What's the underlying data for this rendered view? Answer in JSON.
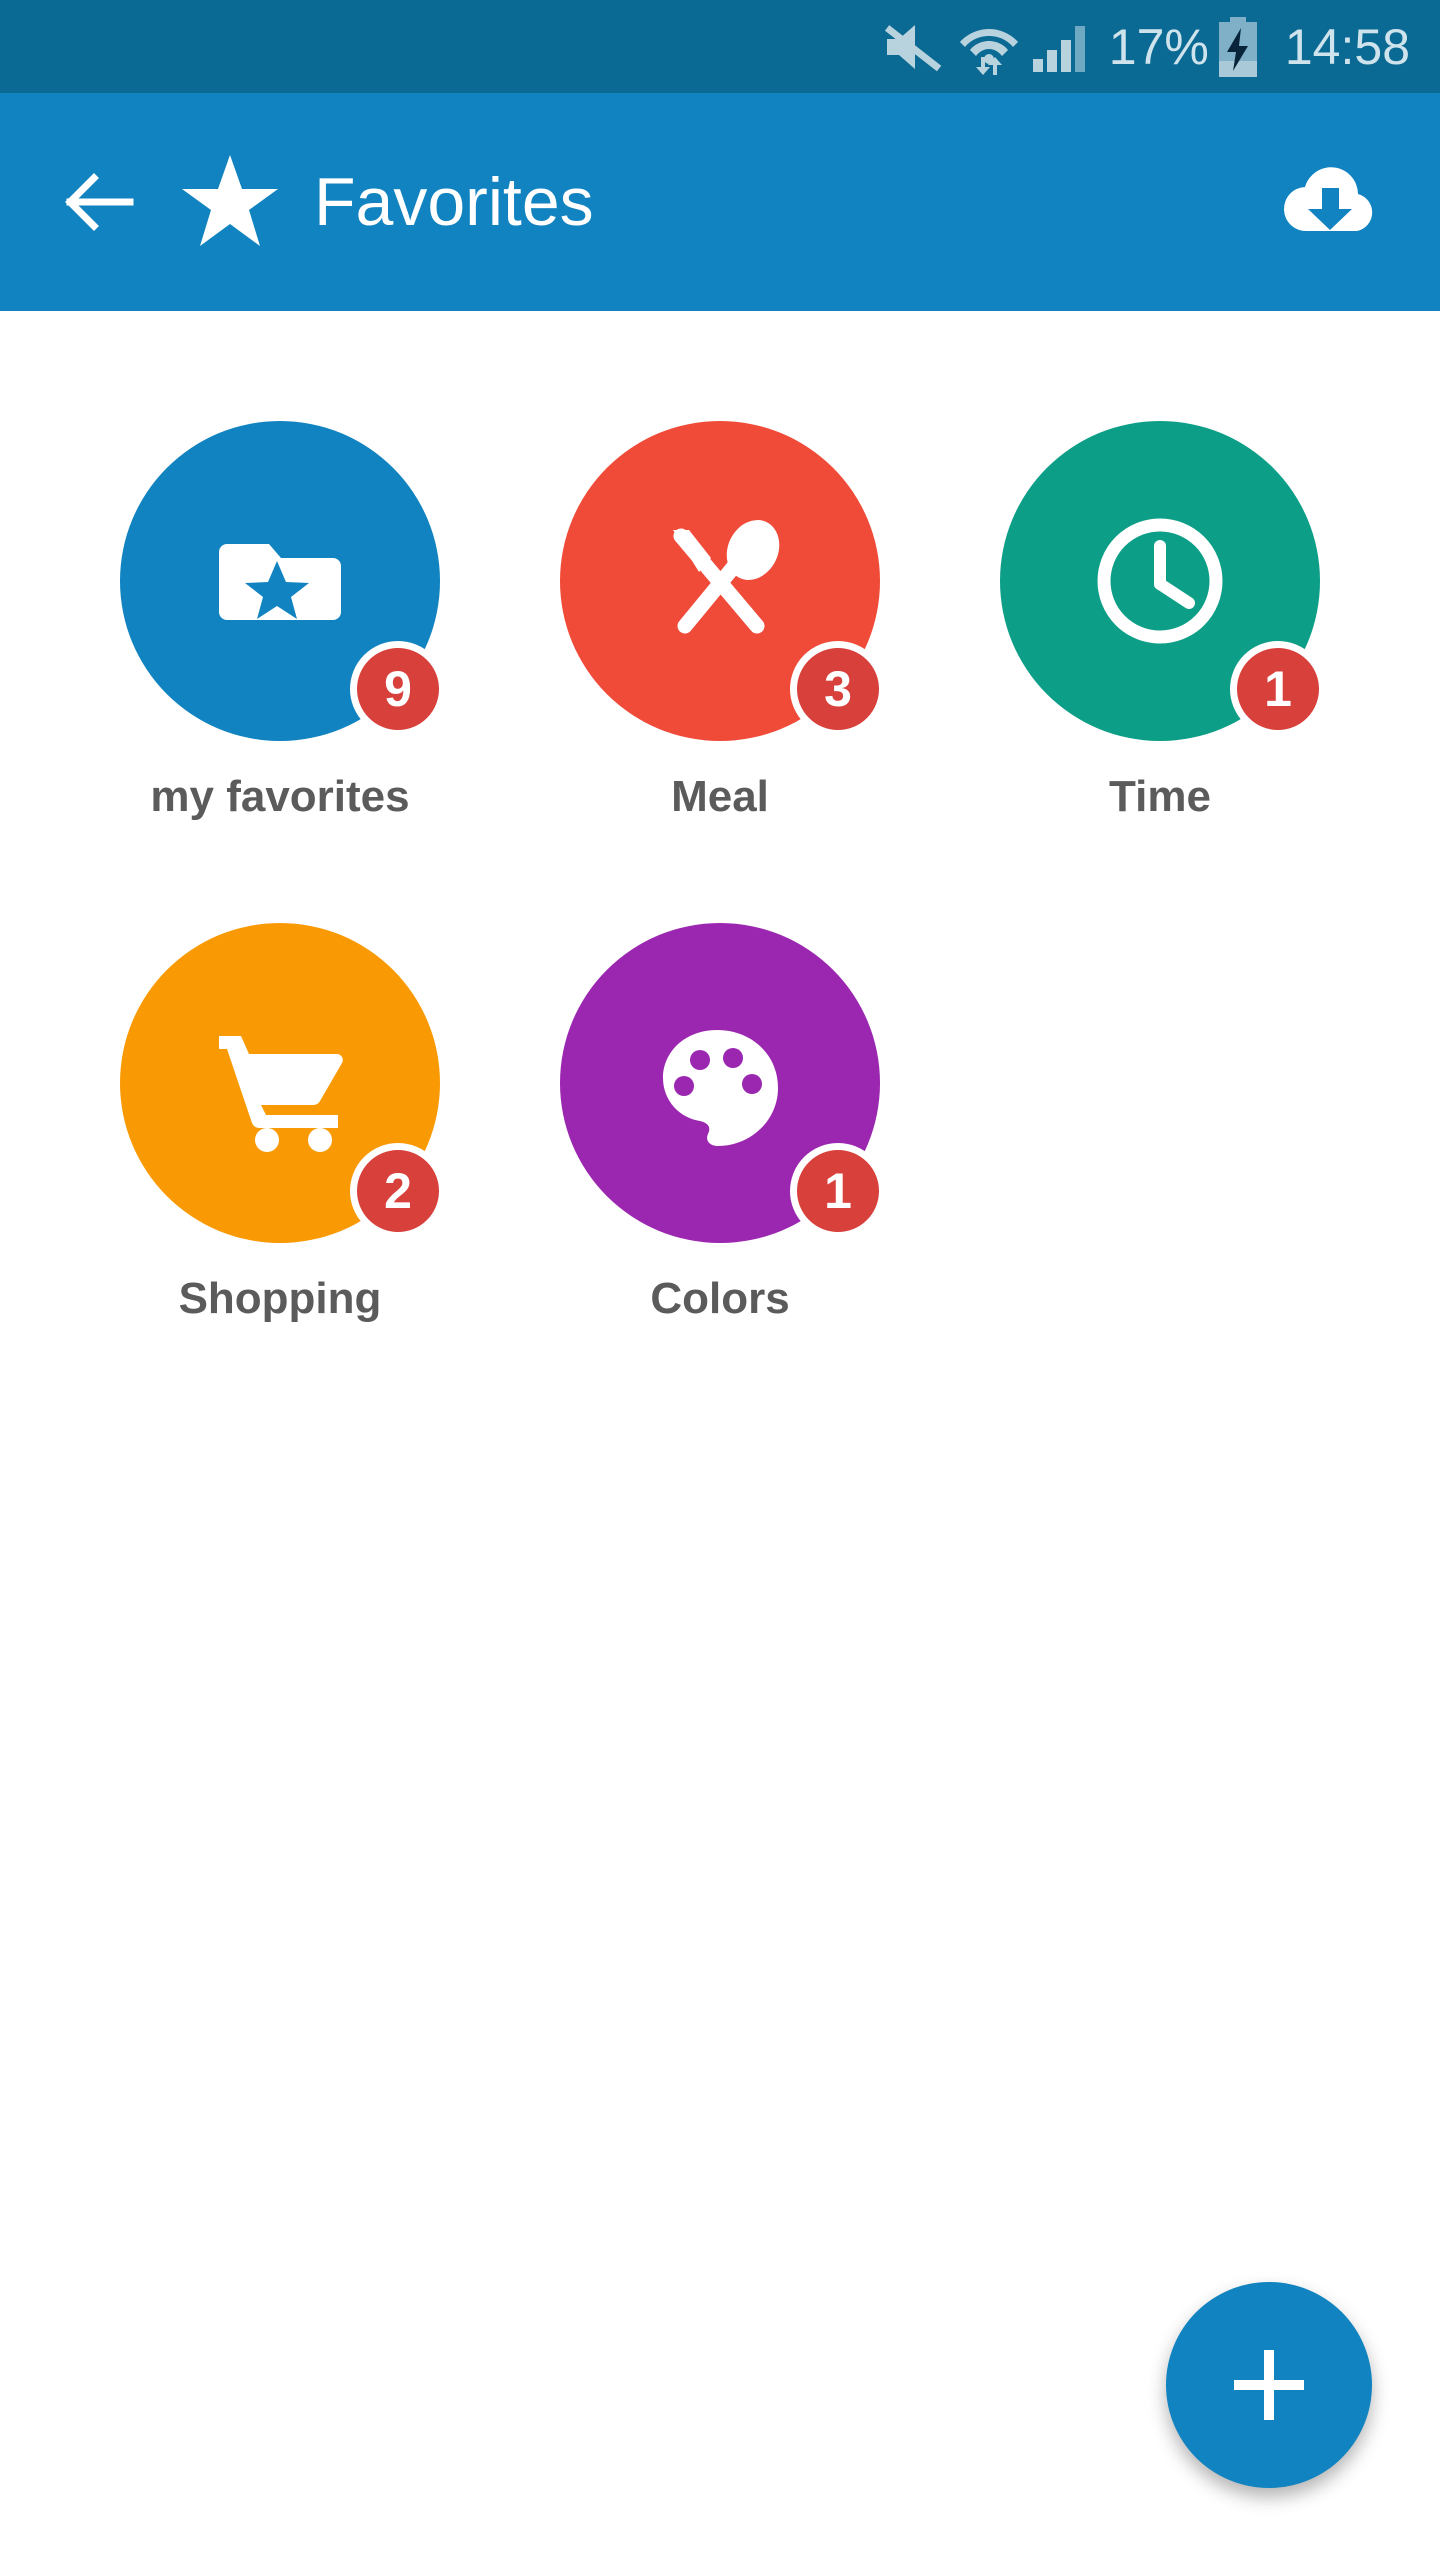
{
  "status_bar": {
    "background": "#0b6a93",
    "text_color": "#cfe3ec",
    "mute_icon": "mute-icon",
    "wifi_icon": "wifi-icon",
    "signal_icon": "cellular-signal-icon",
    "battery_percent": "17%",
    "battery_icon": "battery-charging-icon",
    "clock": "14:58"
  },
  "app_bar": {
    "background": "#1183c0",
    "back_icon": "back-arrow-icon",
    "star_icon": "star-icon",
    "title": "Favorites",
    "action_icon": "cloud-download-icon"
  },
  "content": {
    "background": "#ffffff",
    "items": [
      {
        "label": "my favorites",
        "badge": "9",
        "color": "#1183c0",
        "icon": "folder-star-icon"
      },
      {
        "label": "Meal",
        "badge": "3",
        "color": "#f04a38",
        "icon": "fork-spoon-icon"
      },
      {
        "label": "Time",
        "badge": "1",
        "color": "#0c9e87",
        "icon": "clock-icon"
      },
      {
        "label": "Shopping",
        "badge": "2",
        "color": "#f99a05",
        "icon": "shopping-cart-icon"
      },
      {
        "label": "Colors",
        "badge": "1",
        "color": "#9b27b0",
        "icon": "palette-icon"
      }
    ],
    "badge_color": "#d8403c",
    "label_color": "#5b5b5b"
  },
  "fab": {
    "label": "+",
    "icon": "plus-icon",
    "color": "#1183c0"
  }
}
